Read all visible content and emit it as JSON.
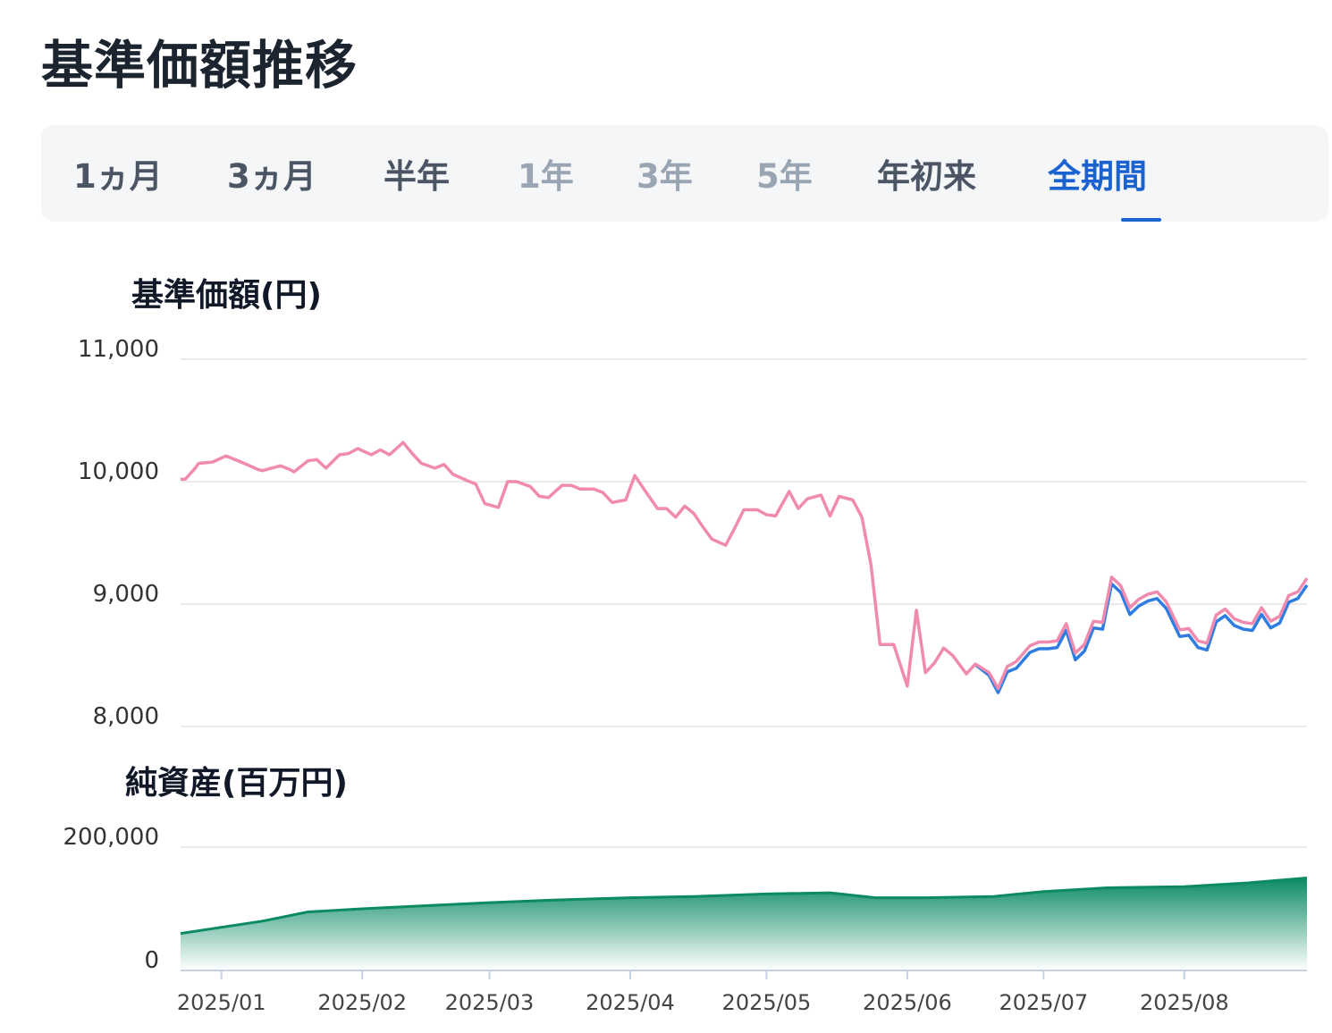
{
  "title": "基準価額推移",
  "tabs": [
    {
      "label": "1ヵ月",
      "state": "enabled"
    },
    {
      "label": "3ヵ月",
      "state": "enabled"
    },
    {
      "label": "半年",
      "state": "enabled"
    },
    {
      "label": "1年",
      "state": "disabled"
    },
    {
      "label": "3年",
      "state": "disabled"
    },
    {
      "label": "5年",
      "state": "disabled"
    },
    {
      "label": "年初来",
      "state": "enabled"
    },
    {
      "label": "全期間",
      "state": "active"
    }
  ],
  "colors": {
    "pink_line": "#f08aaf",
    "blue_line": "#2f7de1",
    "area_top": "#0b8a64",
    "area_bottom": "#ffffff",
    "active_tab": "#1a62d0",
    "grid": "#e3e3e3",
    "axis": "#c6d0e4"
  },
  "chart_data": [
    {
      "type": "line",
      "title": "基準価額(円)",
      "yticks": [
        8000,
        9000,
        10000,
        11000
      ],
      "ytick_labels": [
        "8,000",
        "9,000",
        "10,000",
        "11,000"
      ],
      "ylim": [
        8000,
        11000
      ],
      "grid": true,
      "x_start": "2024-12-23",
      "x_end": "2025-08-28",
      "series": [
        {
          "color": "#f08aaf",
          "points": [
            [
              "2024-12-23",
              10020
            ],
            [
              "2024-12-24",
              10020
            ],
            [
              "2024-12-26",
              10100
            ],
            [
              "2024-12-27",
              10150
            ],
            [
              "2024-12-30",
              10160
            ],
            [
              "2025-01-02",
              10210
            ],
            [
              "2025-01-06",
              10150
            ],
            [
              "2025-01-09",
              10100
            ],
            [
              "2025-01-10",
              10090
            ],
            [
              "2025-01-14",
              10130
            ],
            [
              "2025-01-16",
              10100
            ],
            [
              "2025-01-17",
              10080
            ],
            [
              "2025-01-20",
              10170
            ],
            [
              "2025-01-22",
              10180
            ],
            [
              "2025-01-24",
              10110
            ],
            [
              "2025-01-27",
              10220
            ],
            [
              "2025-01-29",
              10230
            ],
            [
              "2025-01-31",
              10270
            ],
            [
              "2025-02-03",
              10220
            ],
            [
              "2025-02-05",
              10260
            ],
            [
              "2025-02-07",
              10220
            ],
            [
              "2025-02-10",
              10320
            ],
            [
              "2025-02-12",
              10230
            ],
            [
              "2025-02-14",
              10150
            ],
            [
              "2025-02-17",
              10110
            ],
            [
              "2025-02-19",
              10140
            ],
            [
              "2025-02-21",
              10060
            ],
            [
              "2025-02-24",
              10010
            ],
            [
              "2025-02-26",
              9980
            ],
            [
              "2025-02-28",
              9820
            ],
            [
              "2025-03-03",
              9790
            ],
            [
              "2025-03-05",
              10000
            ],
            [
              "2025-03-07",
              10000
            ],
            [
              "2025-03-10",
              9960
            ],
            [
              "2025-03-12",
              9880
            ],
            [
              "2025-03-14",
              9870
            ],
            [
              "2025-03-17",
              9970
            ],
            [
              "2025-03-19",
              9970
            ],
            [
              "2025-03-21",
              9940
            ],
            [
              "2025-03-24",
              9940
            ],
            [
              "2025-03-26",
              9910
            ],
            [
              "2025-03-28",
              9830
            ],
            [
              "2025-03-31",
              9850
            ],
            [
              "2025-04-02",
              10050
            ],
            [
              "2025-04-04",
              9940
            ],
            [
              "2025-04-07",
              9780
            ],
            [
              "2025-04-09",
              9780
            ],
            [
              "2025-04-11",
              9710
            ],
            [
              "2025-04-13",
              9800
            ],
            [
              "2025-04-15",
              9740
            ],
            [
              "2025-04-17",
              9630
            ],
            [
              "2025-04-19",
              9530
            ],
            [
              "2025-04-22",
              9480
            ],
            [
              "2025-04-24",
              9620
            ],
            [
              "2025-04-26",
              9770
            ],
            [
              "2025-04-29",
              9770
            ],
            [
              "2025-05-01",
              9730
            ],
            [
              "2025-05-03",
              9720
            ],
            [
              "2025-05-06",
              9920
            ],
            [
              "2025-05-08",
              9780
            ],
            [
              "2025-05-10",
              9860
            ],
            [
              "2025-05-13",
              9890
            ],
            [
              "2025-05-15",
              9720
            ],
            [
              "2025-05-17",
              9880
            ],
            [
              "2025-05-20",
              9850
            ],
            [
              "2025-05-22",
              9710
            ],
            [
              "2025-05-24",
              9320
            ],
            [
              "2025-05-26",
              8670
            ],
            [
              "2025-05-29",
              8670
            ],
            [
              "2025-06-01",
              8330
            ],
            [
              "2025-06-03",
              8950
            ],
            [
              "2025-06-05",
              8440
            ],
            [
              "2025-06-07",
              8520
            ],
            [
              "2025-06-09",
              8640
            ],
            [
              "2025-06-11",
              8580
            ],
            [
              "2025-06-14",
              8430
            ],
            [
              "2025-06-16",
              8510
            ],
            [
              "2025-06-19",
              8440
            ],
            [
              "2025-06-21",
              8310
            ],
            [
              "2025-06-23",
              8490
            ],
            [
              "2025-06-25",
              8530
            ],
            [
              "2025-06-28",
              8660
            ],
            [
              "2025-06-30",
              8690
            ],
            [
              "2025-07-02",
              8690
            ],
            [
              "2025-07-04",
              8700
            ],
            [
              "2025-07-06",
              8840
            ],
            [
              "2025-07-08",
              8600
            ],
            [
              "2025-07-10",
              8670
            ],
            [
              "2025-07-12",
              8860
            ],
            [
              "2025-07-14",
              8850
            ],
            [
              "2025-07-16",
              9220
            ],
            [
              "2025-07-18",
              9150
            ],
            [
              "2025-07-20",
              8970
            ],
            [
              "2025-07-22",
              9040
            ],
            [
              "2025-07-24",
              9080
            ],
            [
              "2025-07-26",
              9100
            ],
            [
              "2025-07-28",
              9020
            ],
            [
              "2025-07-31",
              8790
            ],
            [
              "2025-08-02",
              8800
            ],
            [
              "2025-08-04",
              8700
            ],
            [
              "2025-08-06",
              8680
            ],
            [
              "2025-08-08",
              8910
            ],
            [
              "2025-08-10",
              8960
            ],
            [
              "2025-08-12",
              8880
            ],
            [
              "2025-08-14",
              8850
            ],
            [
              "2025-08-16",
              8840
            ],
            [
              "2025-08-18",
              8970
            ],
            [
              "2025-08-20",
              8860
            ],
            [
              "2025-08-22",
              8900
            ],
            [
              "2025-08-24",
              9070
            ],
            [
              "2025-08-26",
              9100
            ],
            [
              "2025-08-28",
              9210
            ]
          ]
        }
      ]
    },
    {
      "type": "area",
      "title": "純資産(百万円)",
      "yticks": [
        0,
        200000
      ],
      "ytick_labels": [
        "0",
        "200,000"
      ],
      "ylim": [
        0,
        200000
      ],
      "grid": true,
      "x_categories": [
        "2025/01",
        "2025/02",
        "2025/03",
        "2025/04",
        "2025/05",
        "2025/06",
        "2025/07",
        "2025/08"
      ],
      "series": [
        {
          "color": "#0b8a64",
          "points": [
            [
              "2024-12-23",
              60000
            ],
            [
              "2025-01-01",
              70000
            ],
            [
              "2025-01-10",
              80000
            ],
            [
              "2025-01-20",
              95000
            ],
            [
              "2025-02-01",
              100000
            ],
            [
              "2025-02-15",
              105000
            ],
            [
              "2025-03-01",
              110000
            ],
            [
              "2025-03-15",
              114000
            ],
            [
              "2025-04-01",
              118000
            ],
            [
              "2025-04-15",
              120000
            ],
            [
              "2025-05-01",
              124000
            ],
            [
              "2025-05-15",
              126000
            ],
            [
              "2025-05-25",
              118000
            ],
            [
              "2025-06-05",
              118000
            ],
            [
              "2025-06-20",
              120000
            ],
            [
              "2025-07-01",
              128000
            ],
            [
              "2025-07-15",
              134000
            ],
            [
              "2025-08-01",
              136000
            ],
            [
              "2025-08-15",
              142000
            ],
            [
              "2025-08-28",
              150000
            ]
          ]
        }
      ]
    }
  ]
}
